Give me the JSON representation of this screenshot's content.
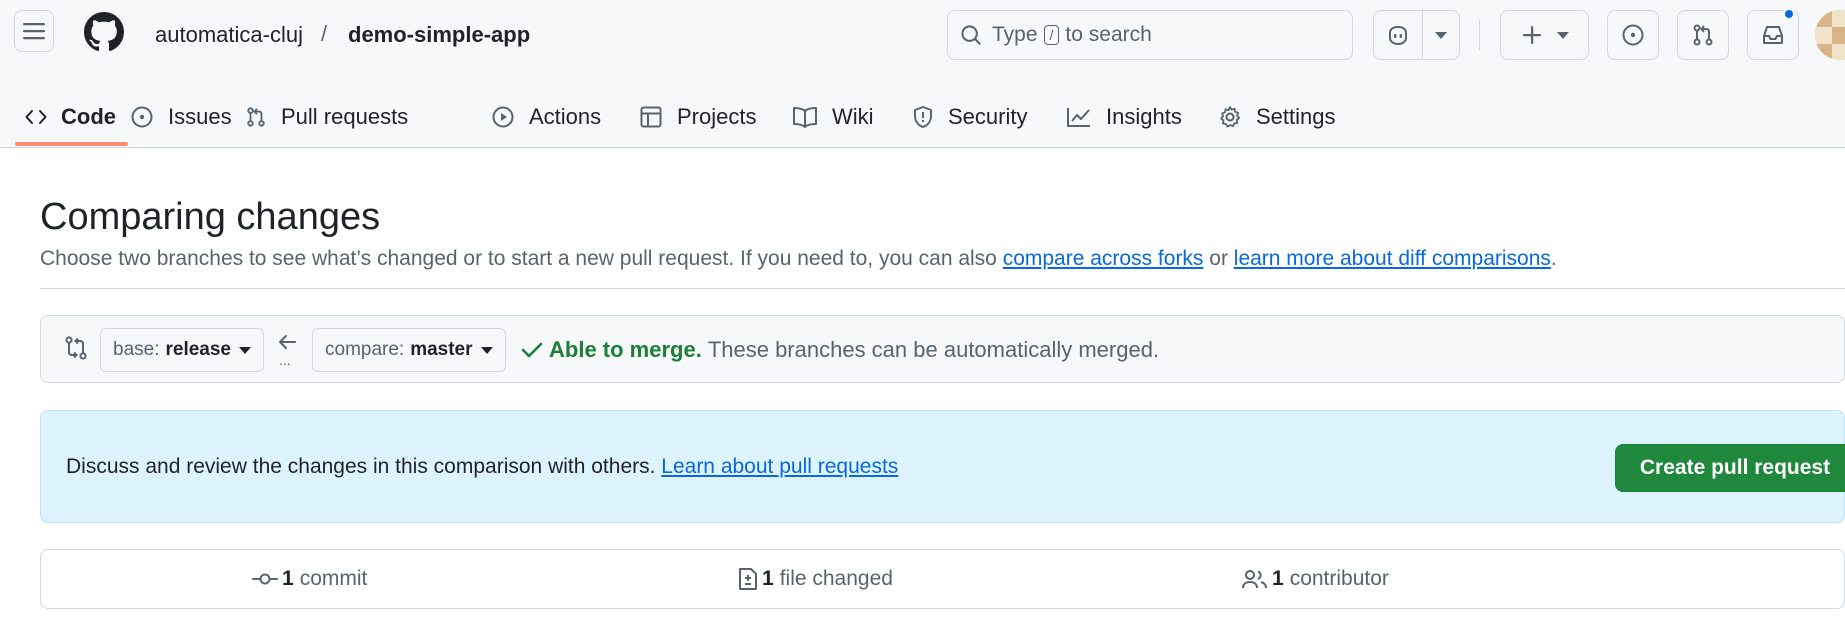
{
  "header": {
    "owner": "automatica-cluj",
    "separator": "/",
    "repo": "demo-simple-app",
    "search": {
      "prefix": "Type",
      "key": "/",
      "suffix": "to search"
    },
    "notification_dot_color": "#0969da"
  },
  "nav": {
    "tabs": [
      {
        "label": "Code",
        "icon": "code-icon",
        "active": true
      },
      {
        "label": "Issues",
        "icon": "issue-opened-icon"
      },
      {
        "label": "Pull requests",
        "icon": "git-pull-request-icon"
      },
      {
        "label": "Actions",
        "icon": "play-icon"
      },
      {
        "label": "Projects",
        "icon": "table-icon"
      },
      {
        "label": "Wiki",
        "icon": "book-icon"
      },
      {
        "label": "Security",
        "icon": "shield-icon"
      },
      {
        "label": "Insights",
        "icon": "graph-icon"
      },
      {
        "label": "Settings",
        "icon": "gear-icon"
      }
    ],
    "active_color": "#fd8c73"
  },
  "main": {
    "title": "Comparing changes",
    "subtitle_prefix": "Choose two branches to see what’s changed or to start a new pull request. If you need to, you can also ",
    "link_forks": "compare across forks",
    "subtitle_mid": " or ",
    "link_diff": "learn more about diff comparisons",
    "subtitle_end": ".",
    "range": {
      "base_label": "base:",
      "base_value": "release",
      "compare_label": "compare:",
      "compare_value": "master",
      "dots": "...",
      "merge_status": "Able to merge.",
      "merge_detail": "These branches can be automatically merged.",
      "ok_color": "#1a7f37"
    },
    "flash": {
      "text": "Discuss and review the changes in this comparison with others. ",
      "link": "Learn about pull requests",
      "button": "Create pull request",
      "button_color": "#1f883d"
    },
    "stats": {
      "commits_count": "1",
      "commits_label": "commit",
      "files_count": "1",
      "files_label": "file changed",
      "contributors_count": "1",
      "contributors_label": "contributor"
    }
  }
}
